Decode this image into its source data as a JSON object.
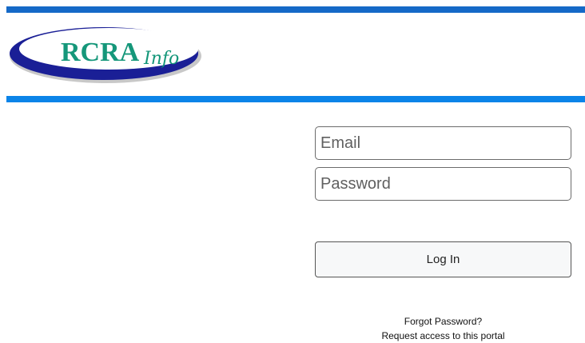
{
  "header": {
    "logo_main": "RCRA",
    "logo_sub": "Info",
    "colors": {
      "top_bar": "#1569c7",
      "rule": "#0b84e8",
      "logo_swoosh": "#1a1f96",
      "logo_text": "#15977a"
    }
  },
  "login": {
    "email_placeholder": "Email",
    "password_placeholder": "Password",
    "login_label": "Log In",
    "forgot_password": "Forgot Password?",
    "request_access": "Request access to this portal"
  }
}
